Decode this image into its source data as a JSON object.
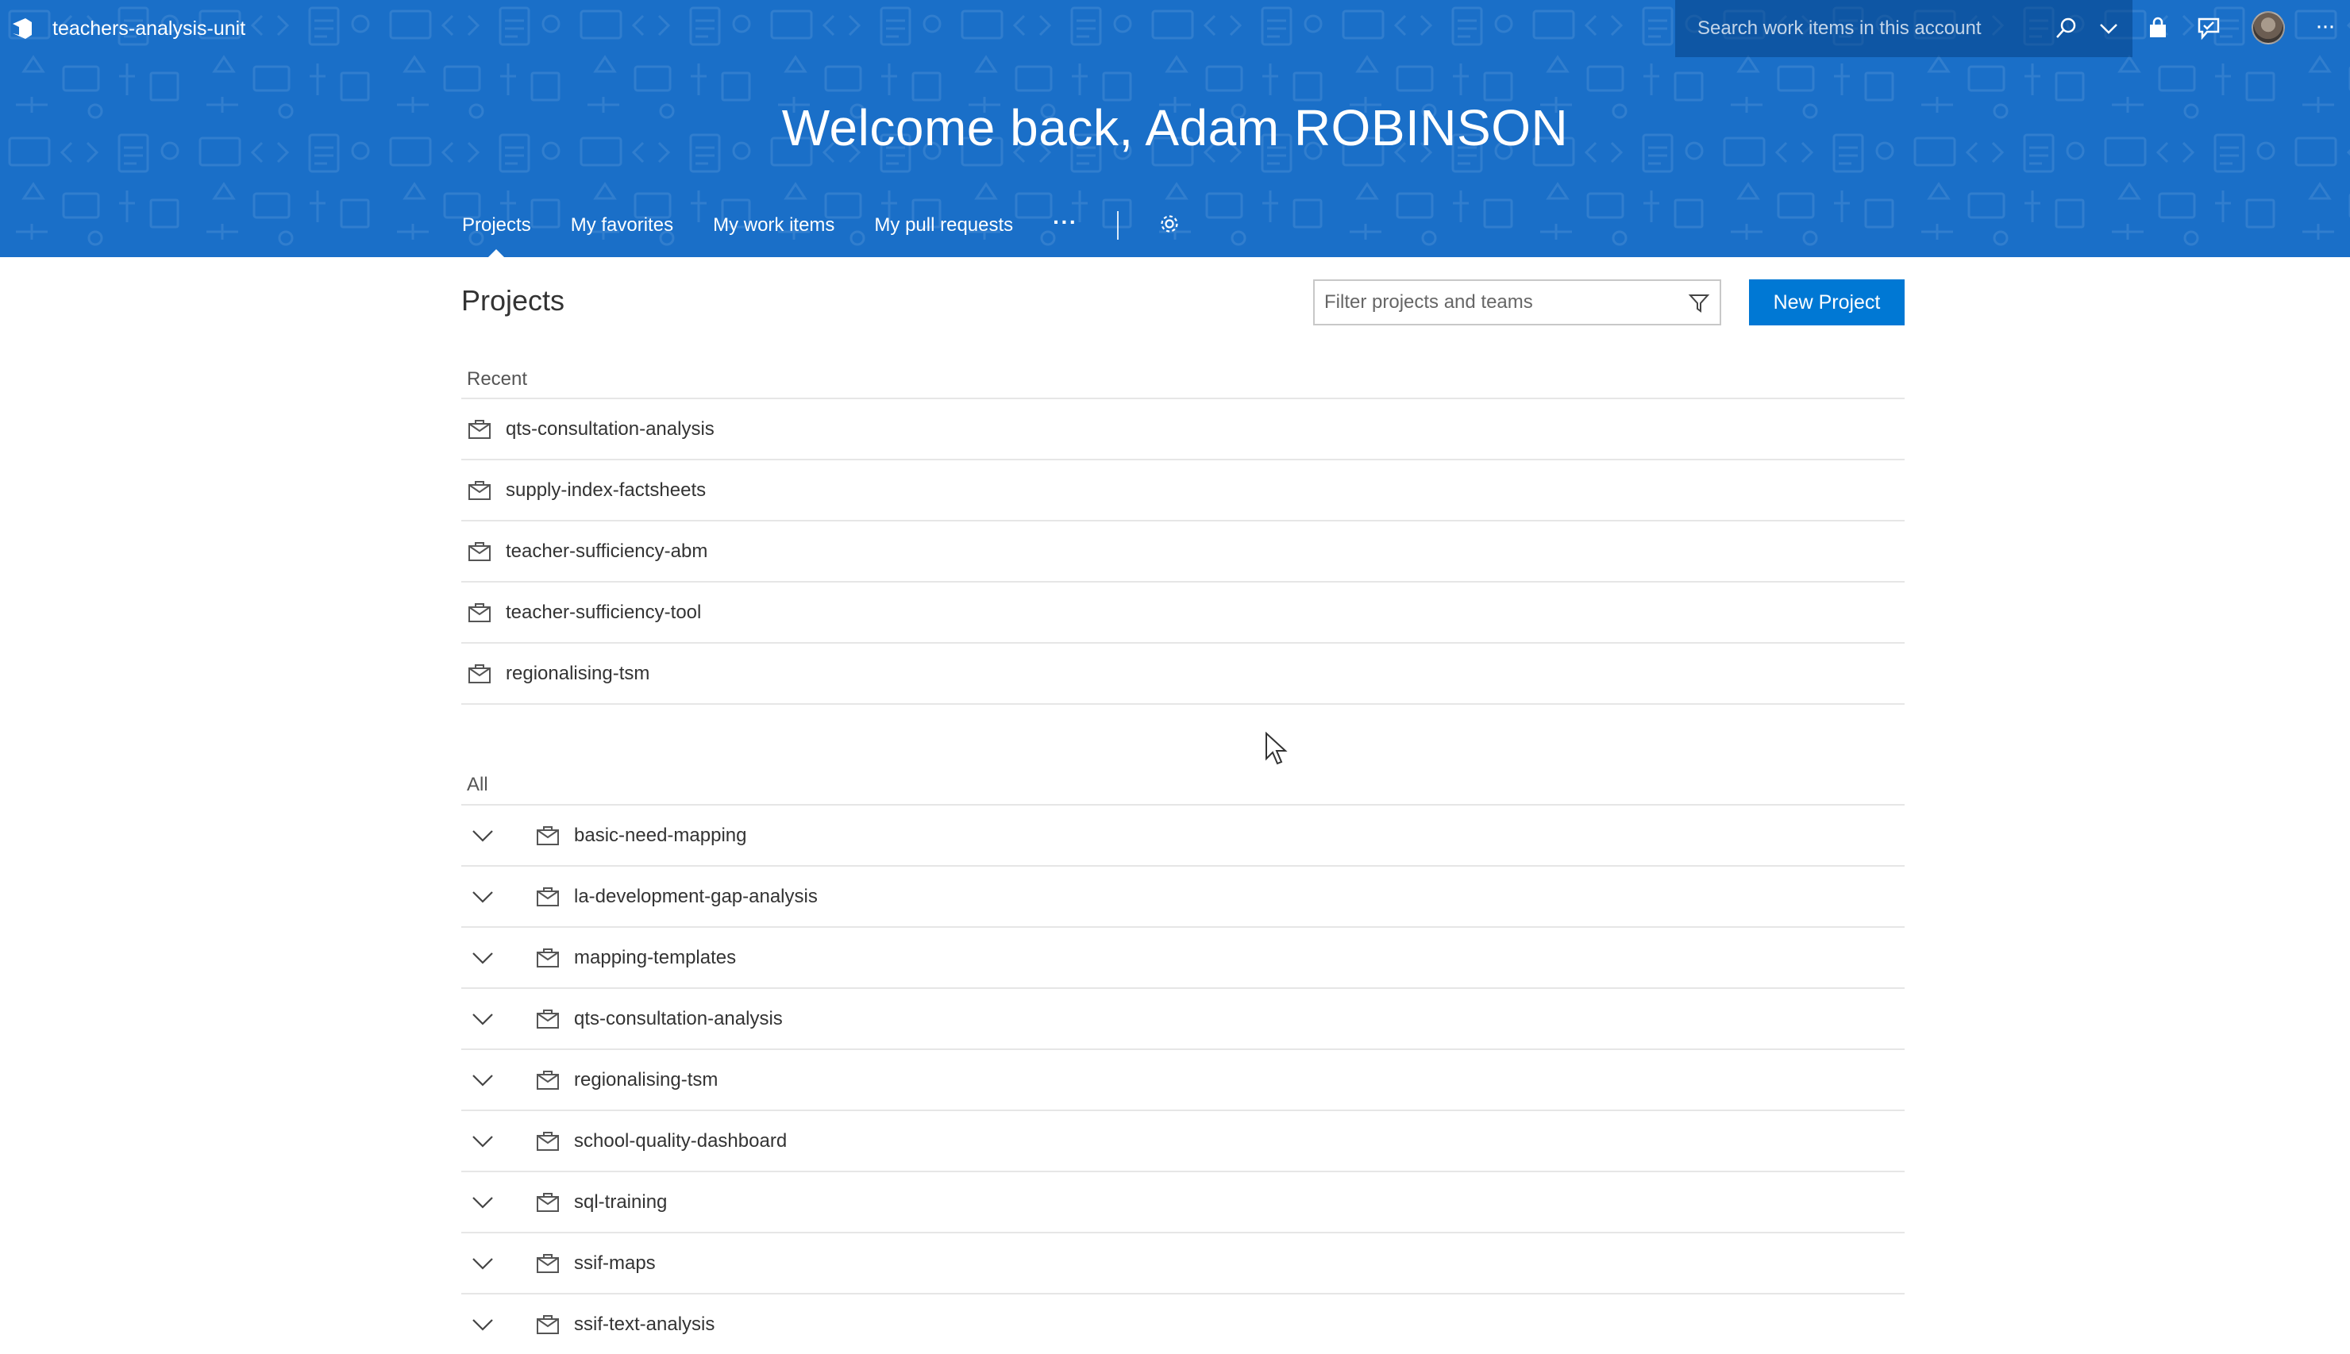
{
  "header": {
    "org_name": "teachers-analysis-unit",
    "search_placeholder": "Search work items in this account",
    "welcome": "Welcome back, Adam ROBINSON",
    "brand_color": "#1a6fc8",
    "icons": [
      "vsts-logo-icon",
      "search-icon",
      "chevron-down-icon",
      "marketplace-bag-icon",
      "feedback-icon",
      "avatar",
      "more-icon"
    ]
  },
  "tabs": [
    {
      "label": "Projects",
      "active": true
    },
    {
      "label": "My favorites",
      "active": false
    },
    {
      "label": "My work items",
      "active": false
    },
    {
      "label": "My pull requests",
      "active": false
    }
  ],
  "tabs_more": "···",
  "main": {
    "title": "Projects",
    "filter_placeholder": "Filter projects and teams",
    "new_project_label": "New Project",
    "accent_color": "#0078d4"
  },
  "recent": {
    "label": "Recent",
    "items": [
      "qts-consultation-analysis",
      "supply-index-factsheets",
      "teacher-sufficiency-abm",
      "teacher-sufficiency-tool",
      "regionalising-tsm"
    ]
  },
  "all": {
    "label": "All",
    "items": [
      "basic-need-mapping",
      "la-development-gap-analysis",
      "mapping-templates",
      "qts-consultation-analysis",
      "regionalising-tsm",
      "school-quality-dashboard",
      "sql-training",
      "ssif-maps",
      "ssif-text-analysis"
    ]
  }
}
